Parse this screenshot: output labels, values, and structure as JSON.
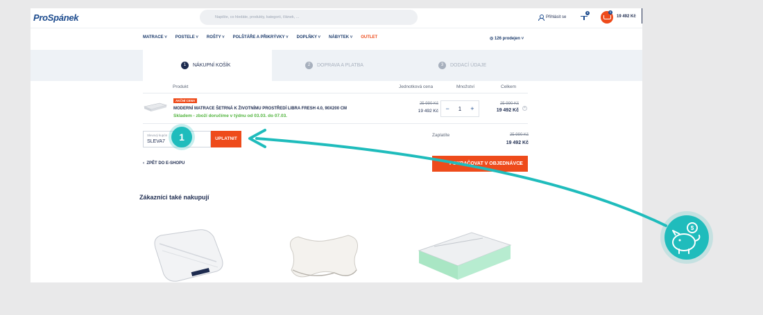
{
  "header": {
    "logo": "ProSpánek",
    "search_placeholder": "Napište, co hledáte, produkty, kategorii, článek, ...",
    "login_label": "Přihlásit se",
    "compare_count": "0",
    "cart_count": "1",
    "cart_total": "19 492 Kč"
  },
  "nav": {
    "items": [
      "MATRACE",
      "POSTELE",
      "ROŠTY",
      "POLŠTÁŘE A PŘIKRÝVKY",
      "DOPLŇKY",
      "NÁBYTEK",
      "OUTLET"
    ],
    "stores": "126 prodejen"
  },
  "steps": [
    {
      "num": "1",
      "label": "NÁKUPNÍ KOŠÍK"
    },
    {
      "num": "2",
      "label": "DOPRAVA A PLATBA"
    },
    {
      "num": "3",
      "label": "DODACÍ ÚDAJE"
    }
  ],
  "table": {
    "headers": [
      "Produkt",
      "Jednotková cena",
      "Množství",
      "Celkem"
    ],
    "item": {
      "badge": "AKČNÍ CENA",
      "name": "MODERNÍ MATRACE ŠETRNÁ K ŽIVOTNÍMU PROSTŘEDÍ LIBRA FRESH 4.0, 90X200 CM",
      "stock": "Skladem - zboží doručíme v týdnu od 03.03. do 07.03.",
      "unit_old": "25 990 Kč",
      "unit_price": "19 492 Kč",
      "qty": "1",
      "total_old": "25 990 Kč",
      "total": "19 492 Kč"
    }
  },
  "coupon": {
    "label": "Slevový kupón",
    "value": "SLEVA7",
    "button": "UPLATNIT"
  },
  "summary": {
    "label": "Zaplatíte",
    "old": "25 990 Kč",
    "total": "19 492 Kč"
  },
  "back_link": "ZPĚT DO E-SHOPU",
  "continue_button": "POKRAČOVAT V OBJEDNÁVCE",
  "related_title": "Zákazníci také nakupují",
  "annotation": {
    "number": "1"
  },
  "colors": {
    "accent": "#ee4b1b",
    "navy": "#1d2b4f",
    "teal": "#1fbcbc",
    "green": "#4fb33b"
  }
}
